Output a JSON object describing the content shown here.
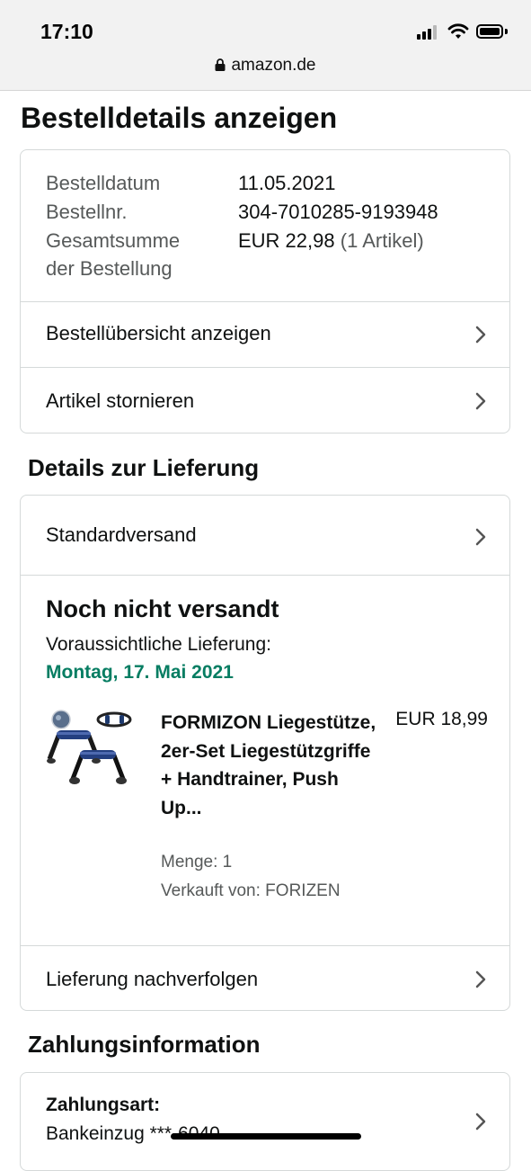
{
  "status_bar": {
    "time": "17:10",
    "url": "amazon.de"
  },
  "page_title": "Bestelldetails anzeigen",
  "order_summary": {
    "date_label": "Bestelldatum",
    "date_value": "11.05.2021",
    "order_no_label": "Bestellnr.",
    "order_no_value": "304-7010285-9193948",
    "total_label_line1": "Gesamtsumme",
    "total_label_line2": "der Bestellung",
    "total_value": "EUR 22,98",
    "total_items": "(1 Artikel)"
  },
  "order_links": {
    "view_summary": "Bestellübersicht anzeigen",
    "cancel_items": "Artikel stornieren"
  },
  "delivery": {
    "section_title": "Details zur Lieferung",
    "shipping_method": "Standardversand",
    "status": "Noch nicht versandt",
    "estimate_label": "Voraussichtliche Lieferung:",
    "estimate_date": "Montag, 17. Mai 2021",
    "product": {
      "title": "FORMIZON Liegestütze, 2er-Set Liegestützgriffe + Handtrainer, Push Up...",
      "price": "EUR 18,99",
      "quantity": "Menge: 1",
      "seller": "Verkauft von: FORIZEN"
    },
    "track_link": "Lieferung nachverfolgen"
  },
  "payment": {
    "section_title": "Zahlungsinformation",
    "method_label": "Zahlungsart:",
    "method_value": "Bankeinzug ***-6040"
  },
  "colors": {
    "accent_green": "#067d62",
    "text": "#0f1111",
    "muted": "#565959",
    "border": "#d5d9d9"
  }
}
